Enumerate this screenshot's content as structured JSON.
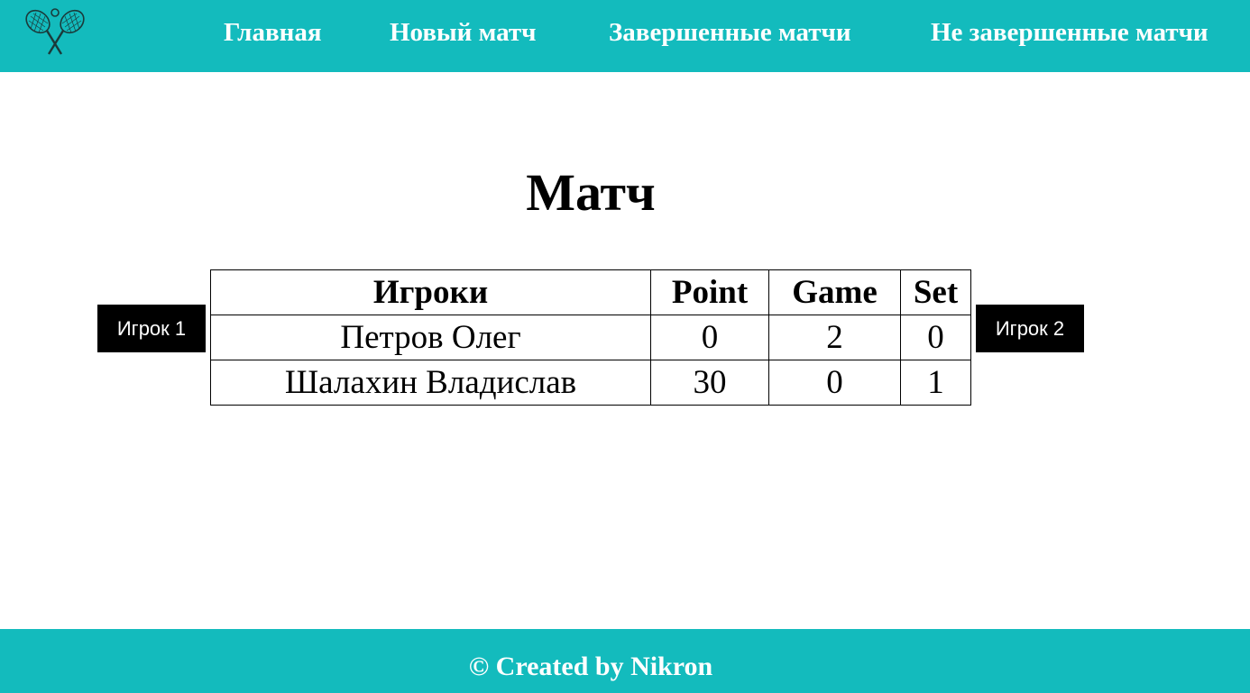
{
  "header": {
    "logo_icon": "tennis-rackets-icon",
    "nav": [
      {
        "label": "Главная"
      },
      {
        "label": "Новый матч"
      },
      {
        "label": "Завершенные матчи"
      },
      {
        "label": "Не завершенные матчи"
      }
    ]
  },
  "main": {
    "title": "Матч",
    "player1_button": "Игрок 1",
    "player2_button": "Игрок 2",
    "table": {
      "columns": [
        "Игроки",
        "Point",
        "Game",
        "Set"
      ],
      "rows": [
        {
          "player": "Петров Олег",
          "point": "0",
          "game": "2",
          "set": "0"
        },
        {
          "player": "Шалахин Владислав",
          "point": "30",
          "game": "0",
          "set": "1"
        }
      ]
    }
  },
  "footer": {
    "text": "© Created by Nikron"
  },
  "colors": {
    "accent": "#13bbbd",
    "button_bg": "#000000",
    "text_light": "#ffffff"
  }
}
